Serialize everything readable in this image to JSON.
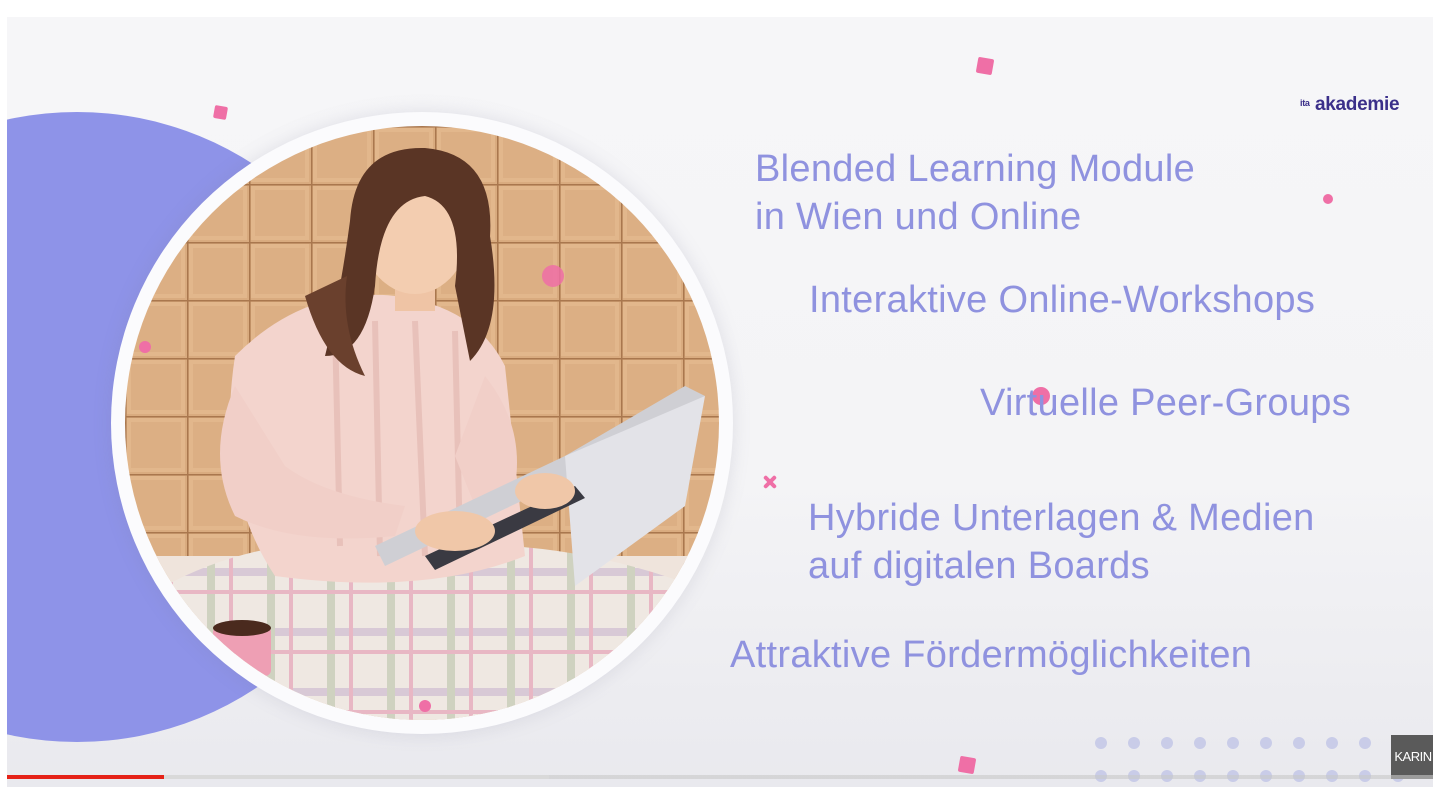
{
  "slide": {
    "logo": {
      "mark": "ita",
      "text": "akademie"
    },
    "headlines": [
      {
        "lines": [
          "Blended Learning Module",
          "in Wien und Online"
        ]
      },
      {
        "lines": [
          "Interaktive Online-Workshops"
        ]
      },
      {
        "lines": [
          "Virtuelle Peer-Groups"
        ]
      },
      {
        "lines": [
          "Hybride Unterlagen & Medien",
          "auf digitalen Boards"
        ]
      },
      {
        "lines": [
          "Attraktive Fördermöglichkeiten"
        ]
      }
    ],
    "photo": {
      "subject": "woman-with-laptop"
    },
    "colors": {
      "accent": "#8e93e8",
      "headline": "#8f92df",
      "confetti": "#ef6fa6",
      "logo": "#3b2f8a"
    }
  },
  "watermark": {
    "text": "KARIN"
  },
  "player": {
    "progress_played_fraction": 0.11,
    "progress_buffered_fraction": 0.38
  }
}
